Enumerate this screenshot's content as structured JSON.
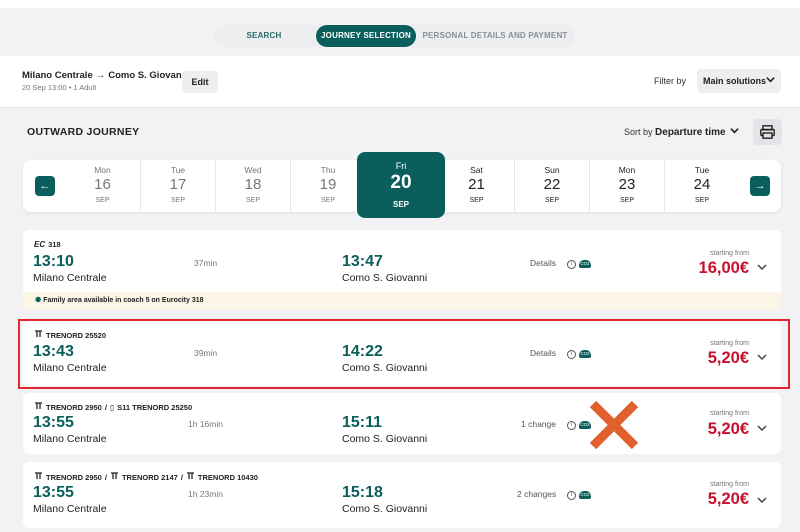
{
  "steps": [
    {
      "label": "SEARCH"
    },
    {
      "label": "JOURNEY SELECTION"
    },
    {
      "label": "PERSONAL DETAILS AND PAYMENT"
    }
  ],
  "header": {
    "from": "Milano Centrale",
    "arrow": "→",
    "to": "Como S. Giovanni",
    "subtitle": "20 Sep 13:00 • 1 Adult",
    "edit_label": "Edit",
    "filter_label": "Filter by",
    "filter_value": "Main solutions"
  },
  "journey": {
    "title": "OUTWARD JOURNEY",
    "sort_label": "Sort by",
    "sort_value": "Departure time"
  },
  "dates": [
    {
      "dow": "Mon",
      "num": "16",
      "mon": "SEP"
    },
    {
      "dow": "Tue",
      "num": "17",
      "mon": "SEP"
    },
    {
      "dow": "Wed",
      "num": "18",
      "mon": "SEP"
    },
    {
      "dow": "Thu",
      "num": "19",
      "mon": "SEP"
    },
    {
      "dow": "Fri",
      "num": "20",
      "mon": "SEP"
    },
    {
      "dow": "Sat",
      "num": "21",
      "mon": "SEP"
    },
    {
      "dow": "Sun",
      "num": "22",
      "mon": "SEP"
    },
    {
      "dow": "Mon",
      "num": "23",
      "mon": "SEP"
    },
    {
      "dow": "Tue",
      "num": "24",
      "mon": "SEP"
    }
  ],
  "solutions": [
    {
      "train1": "318",
      "dep": "13:10",
      "dep_station": "Milano Centrale",
      "duration": "37min",
      "arr": "13:47",
      "arr_station": "Como S. Giovanni",
      "details": "Details",
      "starting_from": "starting from",
      "price": "16,00€",
      "banner": "Family area available in coach 5 on Eurocity 318"
    },
    {
      "train1": "TRENORD 25520",
      "dep": "13:43",
      "dep_station": "Milano Centrale",
      "duration": "39min",
      "arr": "14:22",
      "arr_station": "Como S. Giovanni",
      "details": "Details",
      "starting_from": "starting from",
      "price": "5,20€"
    },
    {
      "train1": "TRENORD 2950",
      "train2": "S11 TRENORD 25250",
      "dep": "13:55",
      "dep_station": "Milano Centrale",
      "duration": "1h 16min",
      "arr": "15:11",
      "arr_station": "Como S. Giovanni",
      "details": "1 change",
      "starting_from": "starting from",
      "price": "5,20€"
    },
    {
      "train1": "TRENORD 2950",
      "train2": "TRENORD 2147",
      "train3": "TRENORD 10430",
      "dep": "13:55",
      "dep_station": "Milano Centrale",
      "duration": "1h 23min",
      "arr": "15:18",
      "arr_station": "Como S. Giovanni",
      "details": "2 changes",
      "starting_from": "starting from",
      "price": "5,20€"
    }
  ],
  "icons": {
    "train": "train-icon",
    "eurocity": "ec-logo-icon",
    "co2": "co2-icon",
    "info": "info-icon",
    "print": "printer-icon",
    "chevron": "chevron-down-icon"
  },
  "colors": {
    "primary": "#0a5f5c",
    "price": "#c8102e",
    "highlight": "#e0282e",
    "cross": "#e0602e"
  },
  "glyphs": {
    "ec": "EC",
    "co2": "CO2",
    "sep": "/",
    "prev": "←",
    "next": "→",
    "chev": "⌵"
  }
}
